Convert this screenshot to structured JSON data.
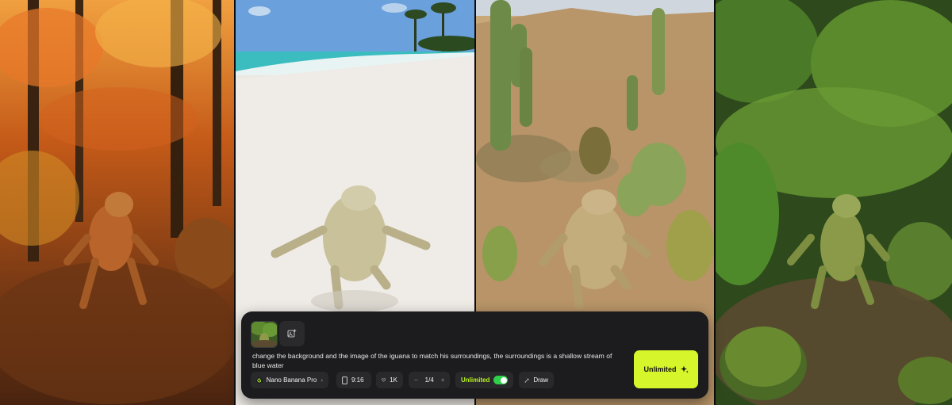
{
  "panels": [
    {
      "scene": "autumn-forest-iguana"
    },
    {
      "scene": "beach-iguana"
    },
    {
      "scene": "desert-cactus-iguana"
    },
    {
      "scene": "jungle-moss-iguana"
    }
  ],
  "prompt": {
    "text": "change the background and the image of the iguana to match his surroundings, the surroundings is a shallow stream of blue water"
  },
  "controls": {
    "model": "Nano Banana Pro",
    "aspect_ratio": "9:16",
    "resolution": "1K",
    "count": "1/4",
    "unlimited_label": "Unlimited",
    "unlimited_on": true,
    "draw_label": "Draw"
  },
  "generate_button": {
    "label": "Unlimited"
  },
  "colors": {
    "accent": "#d6f52a",
    "toggle_on": "#2fd04a",
    "bar_bg": "#1c1c1e"
  }
}
